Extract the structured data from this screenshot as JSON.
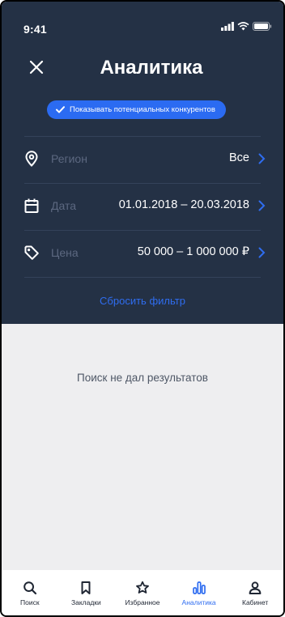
{
  "status_bar": {
    "time": "9:41"
  },
  "header": {
    "title": "Аналитика"
  },
  "competitors_chip": {
    "label": "Показывать потенциальных конкурентов",
    "checked": true
  },
  "filters": [
    {
      "label": "Регион",
      "value": "Все",
      "icon": "location-pin-icon"
    },
    {
      "label": "Дата",
      "value": "01.01.2018 – 20.03.2018",
      "icon": "calendar-icon"
    },
    {
      "label": "Цена",
      "value": "50 000 – 1 000 000 ₽",
      "icon": "price-tag-icon"
    }
  ],
  "reset_label": "Сбросить фильтр",
  "empty_message": "Поиск не дал результатов",
  "tabbar": {
    "tabs": [
      {
        "label": "Поиск",
        "icon": "search-icon",
        "active": false
      },
      {
        "label": "Закладки",
        "icon": "bookmark-icon",
        "active": false
      },
      {
        "label": "Избранное",
        "icon": "star-icon",
        "active": false
      },
      {
        "label": "Аналитика",
        "icon": "analytics-chart-icon",
        "active": true
      },
      {
        "label": "Кабинет",
        "icon": "profile-icon",
        "active": false
      }
    ]
  },
  "colors": {
    "header_bg": "#243145",
    "accent": "#2f6df0",
    "chip_bg": "#2b6bf2",
    "content_bg": "#eeeef0"
  }
}
